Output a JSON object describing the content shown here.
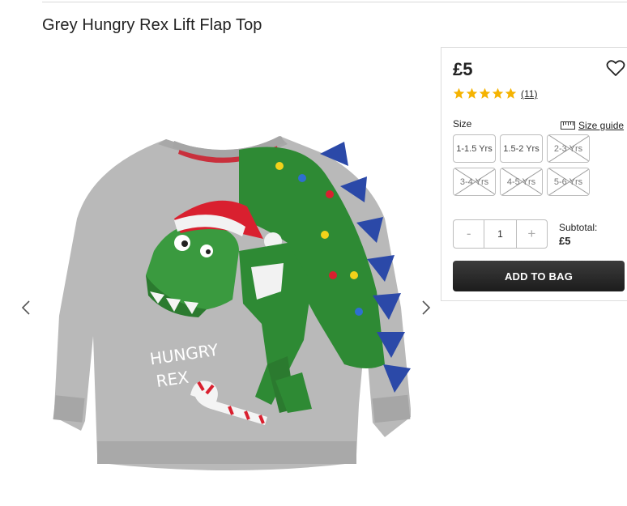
{
  "product": {
    "title": "Grey Hungry Rex Lift Flap Top",
    "image_text_line1": "HUNGRY",
    "image_text_line2": "REX"
  },
  "gallery": {
    "prev_icon": "chevron-left-icon",
    "next_icon": "chevron-right-icon"
  },
  "panel": {
    "price": "£5",
    "rating_stars": 5,
    "review_count": "(11)",
    "size_label": "Size",
    "size_guide_label": "Size guide",
    "sizes": [
      {
        "label": "1-1.5 Yrs",
        "available": true
      },
      {
        "label": "1.5-2 Yrs",
        "available": true
      },
      {
        "label": "2-3 Yrs",
        "available": false
      },
      {
        "label": "3-4 Yrs",
        "available": false
      },
      {
        "label": "4-5 Yrs",
        "available": false
      },
      {
        "label": "5-6 Yrs",
        "available": false
      }
    ],
    "quantity": {
      "minus": "-",
      "value": "1",
      "plus": "+"
    },
    "subtotal_label": "Subtotal:",
    "subtotal_value": "£5",
    "add_to_bag": "ADD TO BAG"
  },
  "colors": {
    "star": "#f5b301",
    "button_dark": "#2a2a2a",
    "garment_grey": "#b9b9b9",
    "dino_green": "#2e8a34",
    "spike_blue": "#2b49a8",
    "hat_red": "#d9202f"
  }
}
